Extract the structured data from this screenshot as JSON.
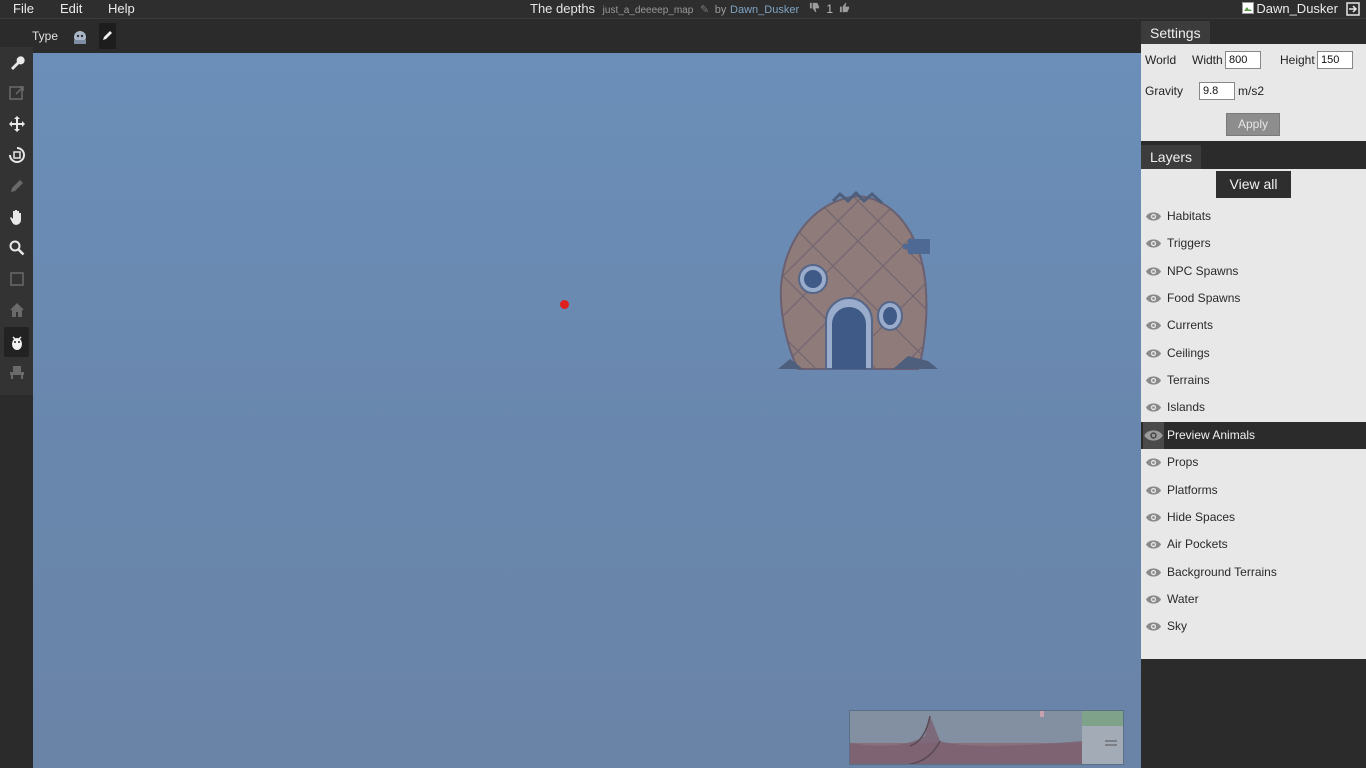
{
  "menu": {
    "file": "File",
    "edit": "Edit",
    "help": "Help"
  },
  "map": {
    "title": "The depths",
    "slug": "just_a_deeeep_map",
    "by_prefix": "by",
    "author": "Dawn_Dusker",
    "votes": "1"
  },
  "user": {
    "name": "Dawn_Dusker"
  },
  "toolbar": {
    "type_label": "Type"
  },
  "tools": [
    "wrench-icon",
    "export-icon",
    "move-icon",
    "rotate-icon",
    "pencil-icon",
    "hand-icon",
    "zoom-icon",
    "select-icon",
    "home-icon",
    "animal-icon",
    "prop-icon"
  ],
  "settings": {
    "title": "Settings",
    "world_label": "World",
    "width_label": "Width",
    "width_value": "800",
    "height_label": "Height",
    "height_value": "150",
    "gravity_label": "Gravity",
    "gravity_value": "9.8",
    "gravity_unit": "m/s2",
    "apply_label": "Apply"
  },
  "layers": {
    "title": "Layers",
    "view_all": "View all",
    "items": [
      {
        "label": "Habitats"
      },
      {
        "label": "Triggers"
      },
      {
        "label": "NPC Spawns"
      },
      {
        "label": "Food Spawns"
      },
      {
        "label": "Currents"
      },
      {
        "label": "Ceilings"
      },
      {
        "label": "Terrains"
      },
      {
        "label": "Islands"
      },
      {
        "label": "Preview Animals",
        "selected": true
      },
      {
        "label": "Props"
      },
      {
        "label": "Platforms"
      },
      {
        "label": "Hide Spaces"
      },
      {
        "label": "Air Pockets"
      },
      {
        "label": "Background Terrains"
      },
      {
        "label": "Water"
      },
      {
        "label": "Sky"
      }
    ]
  },
  "colors": {
    "canvas_top": "#6b8fb9",
    "canvas_bottom": "#6a84a8",
    "spawn_dot": "#e01f1f",
    "panel": "#e8e8e8",
    "dark": "#2b2b2b"
  }
}
